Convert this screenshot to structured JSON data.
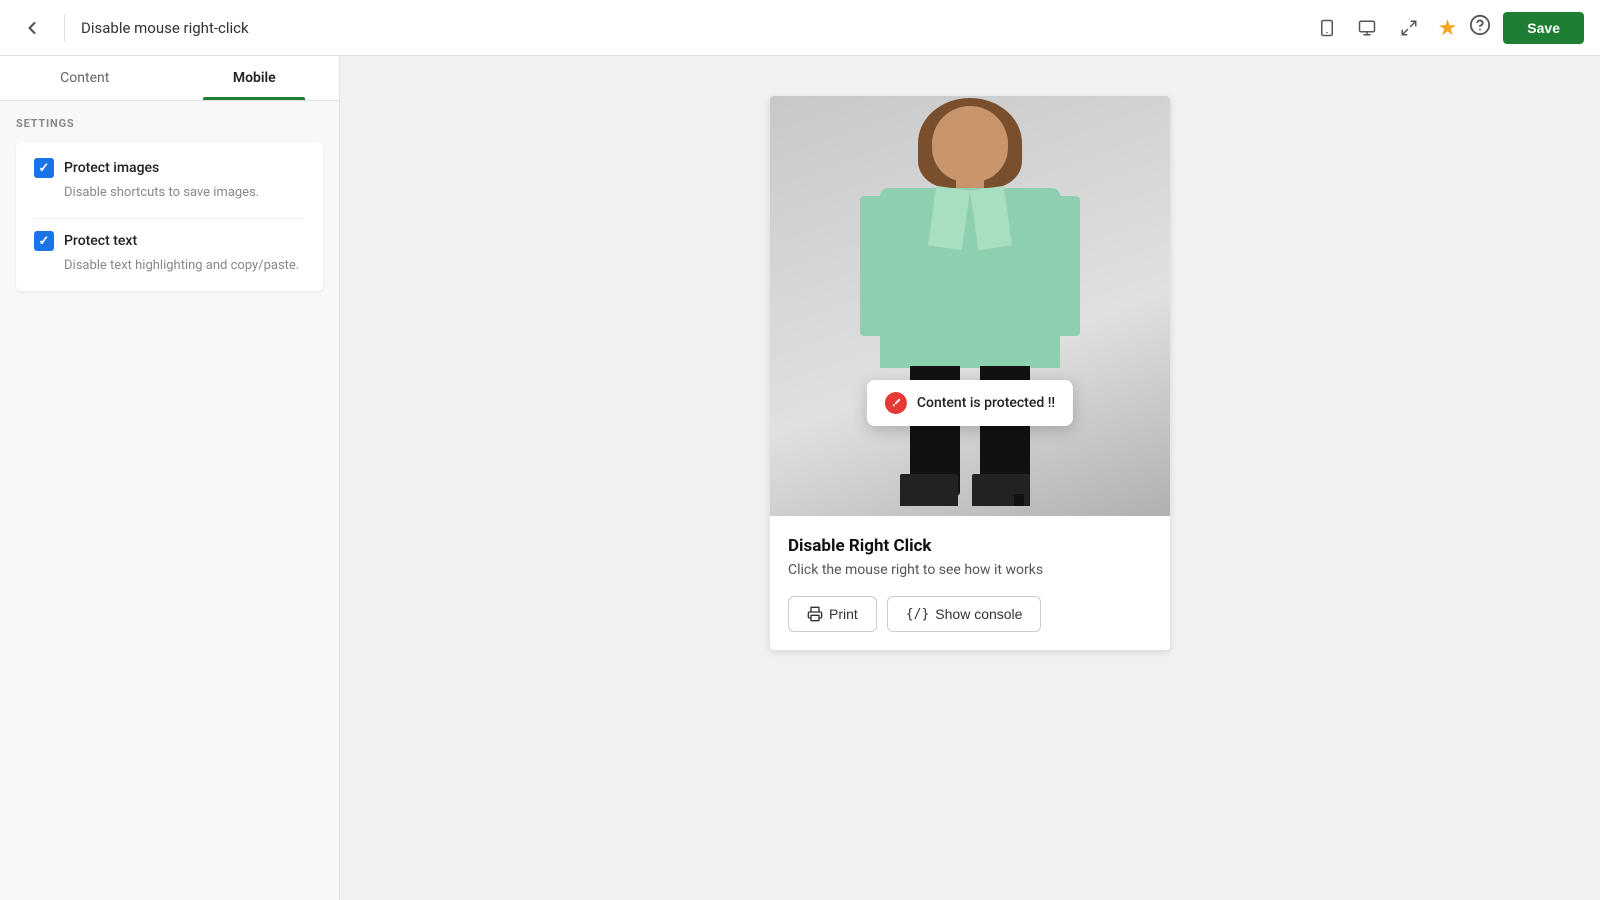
{
  "header": {
    "title": "Disable mouse right-click",
    "save_label": "Save",
    "back_label": "Back"
  },
  "tabs": [
    {
      "id": "content",
      "label": "Content"
    },
    {
      "id": "mobile",
      "label": "Mobile"
    }
  ],
  "active_tab": "mobile",
  "settings": {
    "section_label": "SETTINGS",
    "items": [
      {
        "id": "protect-images",
        "label": "Protect images",
        "description": "Disable shortcuts to save images.",
        "checked": true
      },
      {
        "id": "protect-text",
        "label": "Protect text",
        "description": "Disable text highlighting and copy/paste.",
        "checked": true
      }
    ]
  },
  "preview": {
    "toast_text": "Content is protected !!",
    "heading": "Disable Right Click",
    "subtext": "Click the mouse right to see how it works",
    "btn_print": "Print",
    "btn_console": "Show console"
  }
}
